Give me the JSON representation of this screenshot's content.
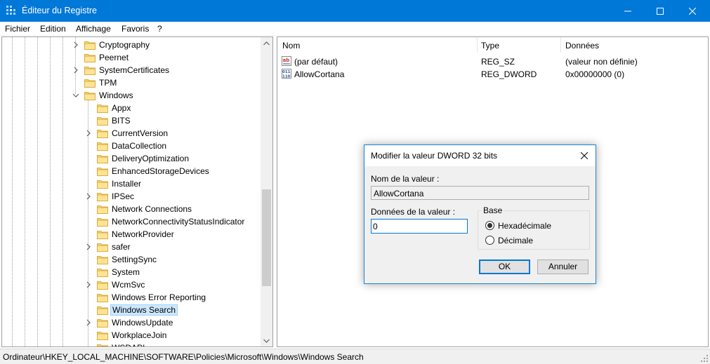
{
  "window": {
    "title": "Éditeur du Registre",
    "accent": "#0078d7"
  },
  "menu": [
    {
      "label": "Fichier",
      "accel": "F"
    },
    {
      "label": "Edition",
      "accel": "E"
    },
    {
      "label": "Affichage",
      "accel": "c"
    },
    {
      "label": "Favoris",
      "accel": "v"
    },
    {
      "label": "?",
      "accel": "?"
    }
  ],
  "tree": {
    "items": [
      {
        "label": "Cryptography",
        "level": 1,
        "expandable": true,
        "expanded": false
      },
      {
        "label": "Peernet",
        "level": 1,
        "expandable": false
      },
      {
        "label": "SystemCertificates",
        "level": 1,
        "expandable": true,
        "expanded": false
      },
      {
        "label": "TPM",
        "level": 1,
        "expandable": false
      },
      {
        "label": "Windows",
        "level": 1,
        "expandable": true,
        "expanded": true
      },
      {
        "label": "Appx",
        "level": 2,
        "expandable": false
      },
      {
        "label": "BITS",
        "level": 2,
        "expandable": false
      },
      {
        "label": "CurrentVersion",
        "level": 2,
        "expandable": true,
        "expanded": false
      },
      {
        "label": "DataCollection",
        "level": 2,
        "expandable": false
      },
      {
        "label": "DeliveryOptimization",
        "level": 2,
        "expandable": false
      },
      {
        "label": "EnhancedStorageDevices",
        "level": 2,
        "expandable": false
      },
      {
        "label": "Installer",
        "level": 2,
        "expandable": false
      },
      {
        "label": "IPSec",
        "level": 2,
        "expandable": true,
        "expanded": false
      },
      {
        "label": "Network Connections",
        "level": 2,
        "expandable": false
      },
      {
        "label": "NetworkConnectivityStatusIndicator",
        "level": 2,
        "expandable": false
      },
      {
        "label": "NetworkProvider",
        "level": 2,
        "expandable": false
      },
      {
        "label": "safer",
        "level": 2,
        "expandable": true,
        "expanded": false
      },
      {
        "label": "SettingSync",
        "level": 2,
        "expandable": false
      },
      {
        "label": "System",
        "level": 2,
        "expandable": false
      },
      {
        "label": "WcmSvc",
        "level": 2,
        "expandable": true,
        "expanded": false
      },
      {
        "label": "Windows Error Reporting",
        "level": 2,
        "expandable": false
      },
      {
        "label": "Windows Search",
        "level": 2,
        "expandable": false,
        "selected": true
      },
      {
        "label": "WindowsUpdate",
        "level": 2,
        "expandable": true,
        "expanded": false
      },
      {
        "label": "WorkplaceJoin",
        "level": 2,
        "expandable": false
      },
      {
        "label": "WSDAPI",
        "level": 2,
        "expandable": false
      }
    ]
  },
  "list": {
    "columns": [
      "Nom",
      "Type",
      "Données"
    ],
    "rows": [
      {
        "icon": "string-value-icon",
        "name": "(par défaut)",
        "type": "REG_SZ",
        "data": "(valeur non définie)"
      },
      {
        "icon": "dword-value-icon",
        "name": "AllowCortana",
        "type": "REG_DWORD",
        "data": "0x00000000 (0)"
      }
    ]
  },
  "status": {
    "path": "Ordinateur\\HKEY_LOCAL_MACHINE\\SOFTWARE\\Policies\\Microsoft\\Windows\\Windows Search"
  },
  "dialog": {
    "title": "Modifier la valeur DWORD 32 bits",
    "name_label": "Nom de la valeur :",
    "name_value": "AllowCortana",
    "data_label": "Données de la valeur :",
    "data_value": "0",
    "base_label": "Base",
    "radio_hex": "Hexadécimale",
    "radio_dec": "Décimale",
    "selected_base": "hex",
    "ok": "OK",
    "cancel": "Annuler"
  }
}
